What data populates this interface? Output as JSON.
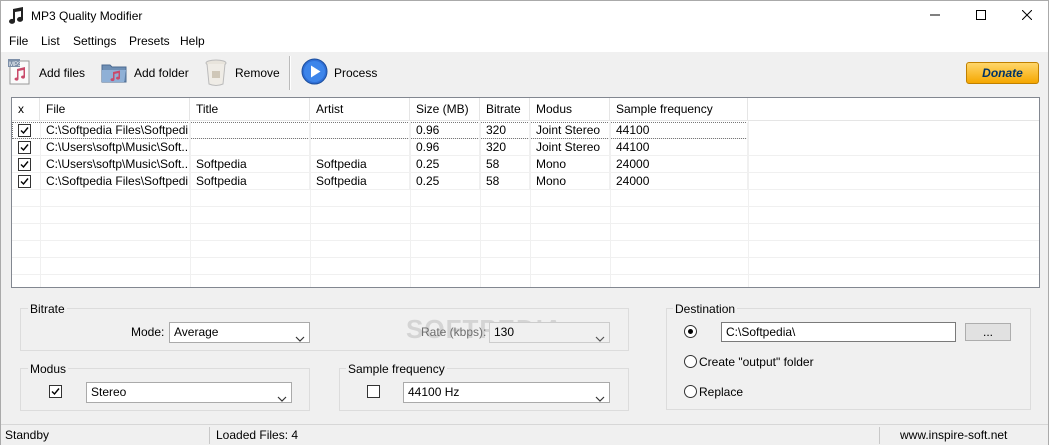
{
  "window": {
    "title": "MP3 Quality Modifier",
    "minimize_icon": "minimize-icon",
    "maximize_icon": "maximize-icon",
    "close_icon": "close-icon"
  },
  "menu": [
    "File",
    "List",
    "Settings",
    "Presets",
    "Help"
  ],
  "toolbar": {
    "add_files": "Add files",
    "add_folder": "Add folder",
    "remove": "Remove",
    "process": "Process",
    "donate": "Donate"
  },
  "table": {
    "columns": [
      "x",
      "File",
      "Title",
      "Artist",
      "Size  (MB)",
      "Bitrate",
      "Modus",
      "Sample frequency"
    ],
    "rows": [
      {
        "checked": true,
        "file": "C:\\Softpedia Files\\Softpedi...",
        "title": "",
        "artist": "",
        "size": "0.96",
        "bitrate": "320",
        "modus": "Joint Stereo",
        "freq": "44100"
      },
      {
        "checked": true,
        "file": "C:\\Users\\softp\\Music\\Soft...",
        "title": "",
        "artist": "",
        "size": "0.96",
        "bitrate": "320",
        "modus": "Joint Stereo",
        "freq": "44100"
      },
      {
        "checked": true,
        "file": "C:\\Users\\softp\\Music\\Soft...",
        "title": "Softpedia",
        "artist": "Softpedia",
        "size": "0.25",
        "bitrate": "58",
        "modus": "Mono",
        "freq": "24000"
      },
      {
        "checked": true,
        "file": "C:\\Softpedia Files\\Softpedi...",
        "title": "Softpedia",
        "artist": "Softpedia",
        "size": "0.25",
        "bitrate": "58",
        "modus": "Mono",
        "freq": "24000"
      }
    ]
  },
  "bitrate": {
    "title": "Bitrate",
    "mode_label": "Mode:",
    "mode_value": "Average",
    "rate_label": "Rate (kbps):",
    "rate_value": "130"
  },
  "modus": {
    "title": "Modus",
    "checked": true,
    "value": "Stereo"
  },
  "sample_frequency": {
    "title": "Sample frequency",
    "checked": false,
    "value": "44100 Hz"
  },
  "destination": {
    "title": "Destination",
    "path": "C:\\Softpedia\\",
    "browse_label": "...",
    "create_output_label": "Create \"output\" folder",
    "replace_label": "Replace",
    "selected": "path"
  },
  "watermark": "SOFTPEDIA",
  "status": {
    "state": "Standby",
    "loaded": "Loaded Files: 4",
    "website": "www.inspire-soft.net"
  }
}
